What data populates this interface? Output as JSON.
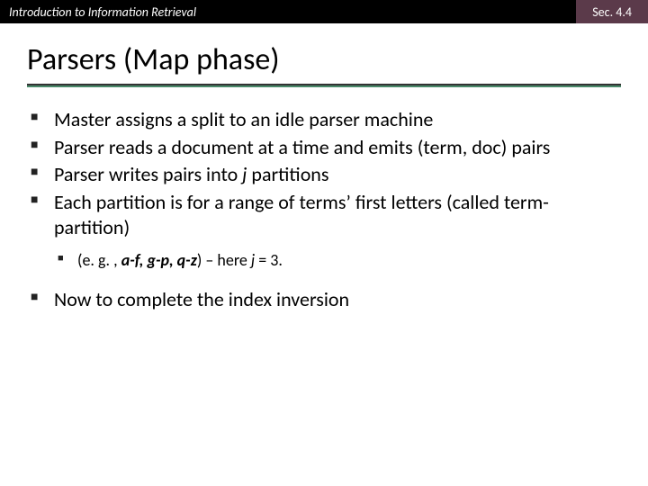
{
  "header": {
    "left": "Introduction to Information Retrieval",
    "right": "Sec. 4.4"
  },
  "title": "Parsers (Map phase)",
  "bullets": {
    "b1": "Master assigns a split to an idle parser machine",
    "b2": "Parser reads a document at a time and emits (term, doc) pairs",
    "b3_pre": "Parser writes pairs into ",
    "b3_j": "j",
    "b3_post": " partitions",
    "b4": "Each partition is for a range of terms’ first letters (called term-partition)",
    "sub_pre": "(e. g. , ",
    "sub_bold": "a-f, g-p, q-z",
    "sub_mid": ") – here ",
    "sub_j": "j",
    "sub_post": " = 3.",
    "b5": "Now to complete the index inversion"
  }
}
